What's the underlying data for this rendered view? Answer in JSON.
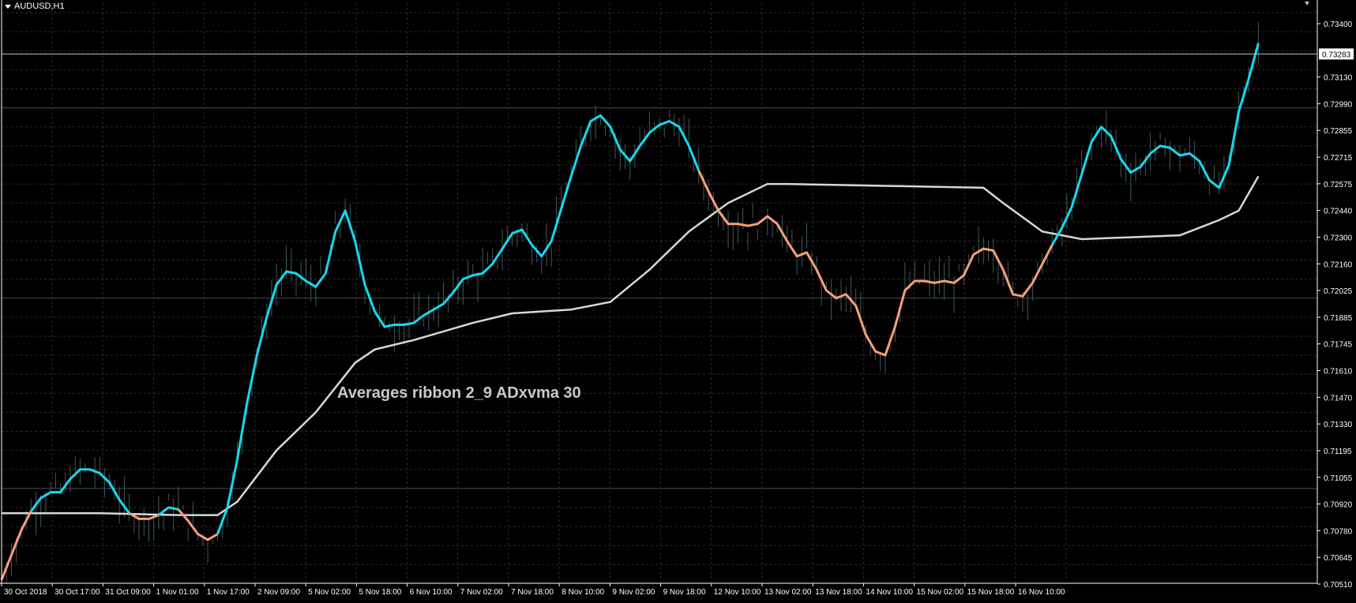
{
  "window": {
    "symbol_label": "AUDUSD,H1",
    "overlay_text": "Averages ribbon 2_9 ADxvma 30"
  },
  "colors": {
    "background": "#000000",
    "grid": "#2b2b2b",
    "axis": "#ffffff",
    "candles": "#3f5a5a",
    "ribbon_up": "#19d8ec",
    "ribbon_down": "#f4a07a",
    "adxvma": "#d7d7d7",
    "price_line": "#b4c0cc"
  },
  "chart_data": {
    "type": "line",
    "symbol": "AUDUSD",
    "timeframe": "H1",
    "ylim": [
      0.7051,
      0.7355
    ],
    "grid": true,
    "y_ticks": [
      "0.73400",
      "0.73283",
      "0.73130",
      "0.72990",
      "0.72855",
      "0.72715",
      "0.72575",
      "0.72440",
      "0.72300",
      "0.72160",
      "0.72025",
      "0.71885",
      "0.71745",
      "0.71610",
      "0.71470",
      "0.71330",
      "0.71195",
      "0.71055",
      "0.70920",
      "0.70780",
      "0.70645",
      "0.70510"
    ],
    "grid_levels": [
      0.735,
      0.734,
      0.733,
      0.732,
      0.731,
      0.73,
      0.729,
      0.728,
      0.727,
      0.726,
      0.725,
      0.724,
      0.723,
      0.722,
      0.721,
      0.72,
      0.719,
      0.718,
      0.717,
      0.716,
      0.715,
      0.714,
      0.713,
      0.712,
      0.711,
      0.71,
      0.709,
      0.708,
      0.707,
      0.706
    ],
    "x_ticks": [
      "30 Oct 2018",
      "30 Oct 17:00",
      "31 Oct 09:00",
      "1 Nov 01:00",
      "1 Nov 17:00",
      "2 Nov 09:00",
      "5 Nov 02:00",
      "5 Nov 18:00",
      "6 Nov 10:00",
      "7 Nov 02:00",
      "7 Nov 18:00",
      "8 Nov 10:00",
      "9 Nov 02:00",
      "9 Nov 18:00",
      "12 Nov 10:00",
      "13 Nov 02:00",
      "13 Nov 18:00",
      "14 Nov 10:00",
      "15 Nov 02:00",
      "15 Nov 18:00",
      "16 Nov 10:00"
    ],
    "current_price": "0.73283",
    "current_price_value": 0.73283,
    "reference_levels": [
      0.73,
      0.72,
      0.71
    ],
    "ribbon_segments": [
      {
        "trend": "down",
        "points": [
          [
            0,
            0.7052
          ],
          [
            1,
            0.7065
          ],
          [
            2,
            0.7078
          ],
          [
            3,
            0.7088
          ]
        ]
      },
      {
        "trend": "up",
        "points": [
          [
            3,
            0.7088
          ],
          [
            4,
            0.7095
          ],
          [
            5,
            0.7098
          ],
          [
            6,
            0.7098
          ],
          [
            7,
            0.7105
          ],
          [
            8,
            0.711
          ],
          [
            9,
            0.711
          ],
          [
            10,
            0.7108
          ],
          [
            11,
            0.7103
          ],
          [
            12,
            0.7094
          ],
          [
            13,
            0.7087
          ]
        ]
      },
      {
        "trend": "down",
        "points": [
          [
            13,
            0.7087
          ],
          [
            14,
            0.7084
          ],
          [
            15,
            0.7084
          ],
          [
            16,
            0.7086
          ]
        ]
      },
      {
        "trend": "up",
        "points": [
          [
            16,
            0.7086
          ],
          [
            17,
            0.709
          ],
          [
            18,
            0.7089
          ]
        ]
      },
      {
        "trend": "down",
        "points": [
          [
            18,
            0.7089
          ],
          [
            19,
            0.7083
          ],
          [
            20,
            0.7076
          ],
          [
            21,
            0.7073
          ],
          [
            22,
            0.7076
          ]
        ]
      },
      {
        "trend": "up",
        "points": [
          [
            22,
            0.7076
          ],
          [
            23,
            0.709
          ],
          [
            24,
            0.7115
          ],
          [
            25,
            0.7145
          ],
          [
            26,
            0.717
          ],
          [
            27,
            0.719
          ],
          [
            28,
            0.7207
          ],
          [
            29,
            0.7214
          ],
          [
            30,
            0.7213
          ],
          [
            31,
            0.7209
          ],
          [
            32,
            0.7206
          ],
          [
            33,
            0.7213
          ],
          [
            34,
            0.7235
          ],
          [
            35,
            0.7246
          ],
          [
            36,
            0.723
          ],
          [
            37,
            0.7207
          ],
          [
            38,
            0.7193
          ],
          [
            39,
            0.7185
          ],
          [
            40,
            0.7186
          ],
          [
            41,
            0.7186
          ],
          [
            42,
            0.7187
          ],
          [
            43,
            0.7191
          ],
          [
            44,
            0.7194
          ],
          [
            45,
            0.7197
          ],
          [
            46,
            0.7203
          ],
          [
            47,
            0.721
          ],
          [
            48,
            0.7212
          ],
          [
            49,
            0.7213
          ],
          [
            50,
            0.7218
          ],
          [
            51,
            0.7226
          ],
          [
            52,
            0.7234
          ],
          [
            53,
            0.7236
          ],
          [
            54,
            0.7228
          ],
          [
            55,
            0.7222
          ],
          [
            56,
            0.723
          ],
          [
            57,
            0.7247
          ],
          [
            58,
            0.7264
          ],
          [
            59,
            0.728
          ],
          [
            60,
            0.7293
          ],
          [
            61,
            0.7296
          ],
          [
            62,
            0.729
          ],
          [
            63,
            0.7278
          ],
          [
            64,
            0.7272
          ],
          [
            65,
            0.728
          ],
          [
            66,
            0.7287
          ],
          [
            67,
            0.7291
          ],
          [
            68,
            0.7293
          ],
          [
            69,
            0.729
          ],
          [
            70,
            0.728
          ],
          [
            71,
            0.7267
          ]
        ]
      },
      {
        "trend": "down",
        "points": [
          [
            71,
            0.7267
          ],
          [
            72,
            0.7256
          ],
          [
            73,
            0.7246
          ],
          [
            74,
            0.7239
          ],
          [
            75,
            0.7239
          ],
          [
            76,
            0.7238
          ],
          [
            77,
            0.7239
          ],
          [
            78,
            0.7243
          ],
          [
            79,
            0.7239
          ],
          [
            80,
            0.723
          ],
          [
            81,
            0.7222
          ],
          [
            82,
            0.7224
          ],
          [
            83,
            0.7215
          ],
          [
            84,
            0.7204
          ],
          [
            85,
            0.72
          ],
          [
            86,
            0.7202
          ],
          [
            87,
            0.7196
          ],
          [
            88,
            0.7181
          ],
          [
            89,
            0.7172
          ],
          [
            90,
            0.717
          ],
          [
            91,
            0.7185
          ],
          [
            92,
            0.7204
          ],
          [
            93,
            0.7209
          ],
          [
            94,
            0.7209
          ],
          [
            95,
            0.7208
          ],
          [
            96,
            0.7209
          ],
          [
            97,
            0.7208
          ],
          [
            98,
            0.7212
          ],
          [
            99,
            0.7223
          ],
          [
            100,
            0.7226
          ],
          [
            101,
            0.7225
          ],
          [
            102,
            0.7215
          ],
          [
            103,
            0.7202
          ],
          [
            104,
            0.7201
          ],
          [
            105,
            0.7208
          ],
          [
            106,
            0.7218
          ],
          [
            107,
            0.7228
          ]
        ]
      },
      {
        "trend": "up",
        "points": [
          [
            107,
            0.7228
          ],
          [
            108,
            0.7237
          ],
          [
            109,
            0.7248
          ],
          [
            110,
            0.7265
          ],
          [
            111,
            0.7282
          ],
          [
            112,
            0.729
          ],
          [
            113,
            0.7285
          ],
          [
            114,
            0.7273
          ],
          [
            115,
            0.7266
          ],
          [
            116,
            0.7269
          ],
          [
            117,
            0.7276
          ],
          [
            118,
            0.728
          ],
          [
            119,
            0.7279
          ],
          [
            120,
            0.7275
          ],
          [
            121,
            0.7276
          ],
          [
            122,
            0.7272
          ],
          [
            123,
            0.7262
          ],
          [
            124,
            0.7258
          ],
          [
            125,
            0.727
          ],
          [
            126,
            0.7298
          ],
          [
            127,
            0.7315
          ],
          [
            128,
            0.7334
          ]
        ]
      }
    ],
    "adxvma": [
      [
        0,
        0.7087
      ],
      [
        10,
        0.7087
      ],
      [
        18,
        0.7086
      ],
      [
        22,
        0.7086
      ],
      [
        24,
        0.7093
      ],
      [
        28,
        0.712
      ],
      [
        32,
        0.714
      ],
      [
        36,
        0.7166
      ],
      [
        38,
        0.7173
      ],
      [
        42,
        0.7178
      ],
      [
        48,
        0.7187
      ],
      [
        52,
        0.7192
      ],
      [
        58,
        0.7194
      ],
      [
        62,
        0.7198
      ],
      [
        66,
        0.7215
      ],
      [
        70,
        0.7235
      ],
      [
        74,
        0.725
      ],
      [
        78,
        0.726
      ],
      [
        80,
        0.726
      ],
      [
        90,
        0.7259
      ],
      [
        100,
        0.7258
      ],
      [
        102,
        0.725
      ],
      [
        106,
        0.7235
      ],
      [
        110,
        0.7231
      ],
      [
        115,
        0.7232
      ],
      [
        120,
        0.7233
      ],
      [
        124,
        0.7241
      ],
      [
        126,
        0.7246
      ],
      [
        128,
        0.7264
      ]
    ],
    "candle_seed": 7
  }
}
